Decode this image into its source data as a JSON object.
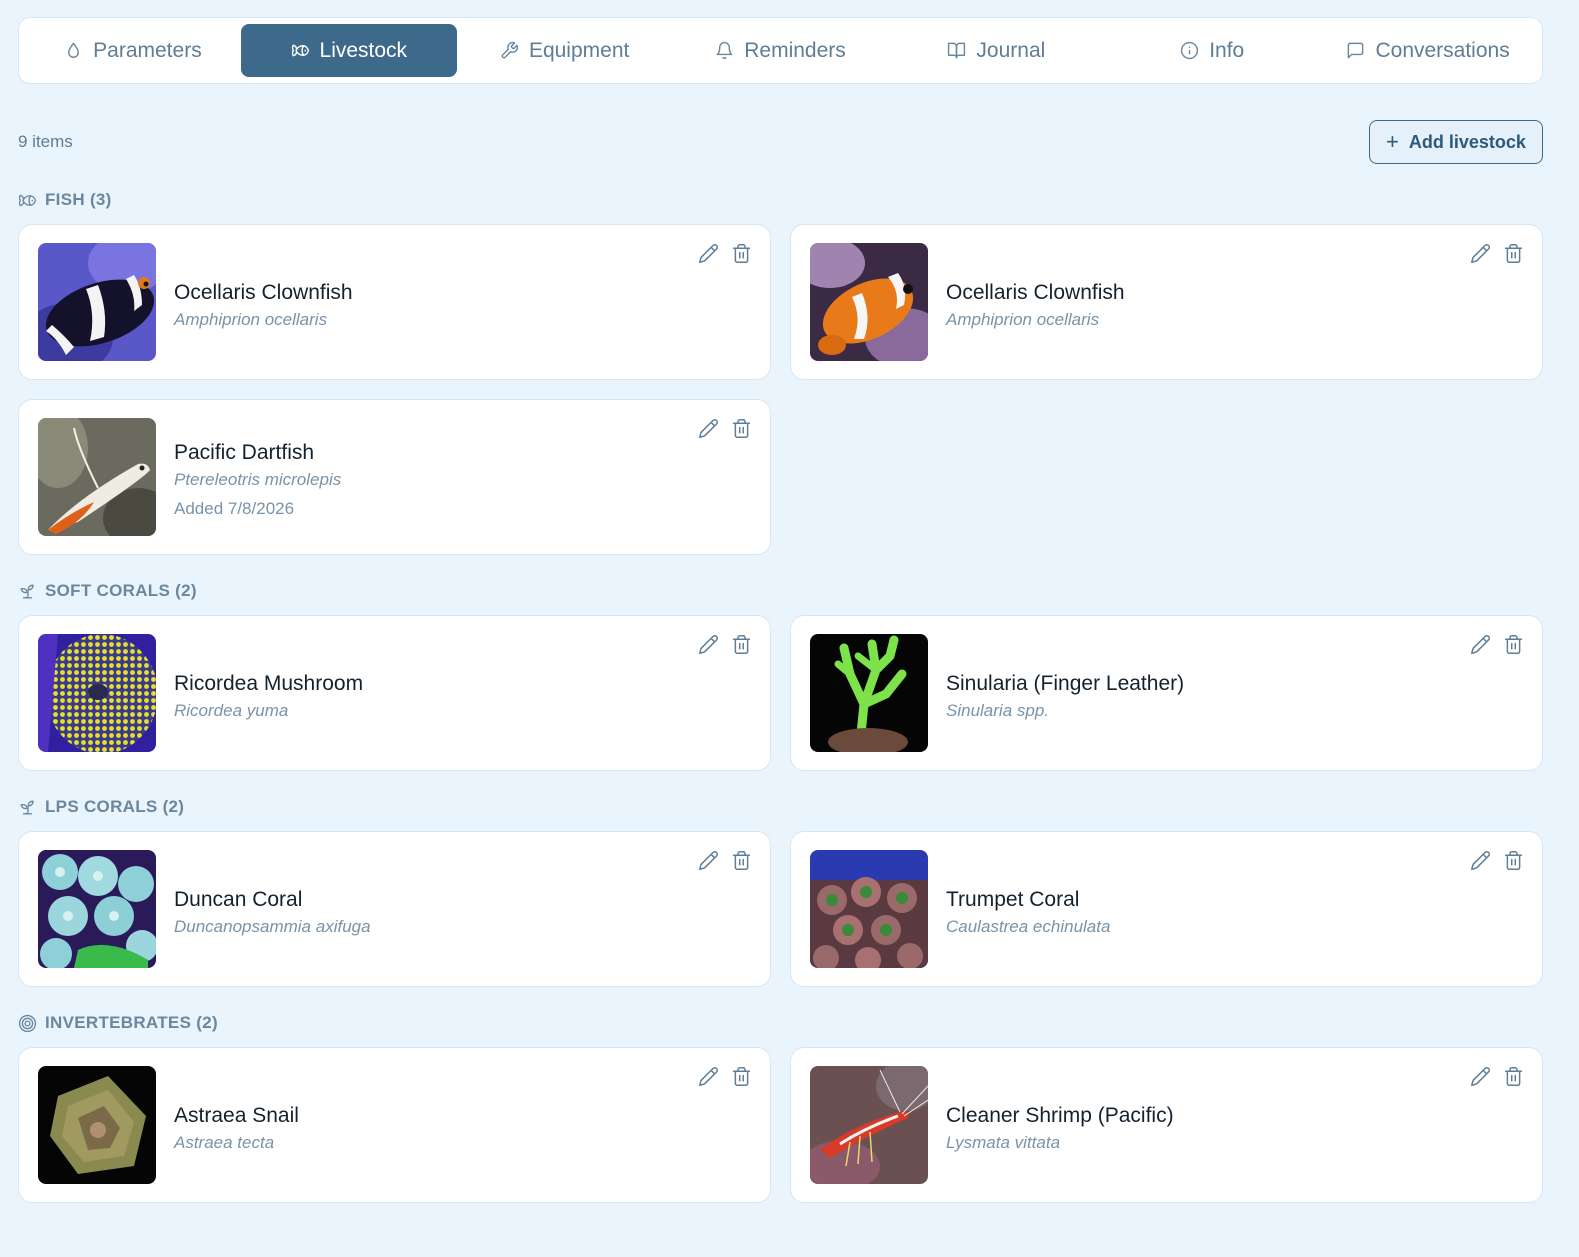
{
  "tabs": [
    {
      "label": "Parameters",
      "icon": "droplet-icon",
      "active": false
    },
    {
      "label": "Livestock",
      "icon": "fish-icon",
      "active": true
    },
    {
      "label": "Equipment",
      "icon": "wrench-icon",
      "active": false
    },
    {
      "label": "Reminders",
      "icon": "bell-icon",
      "active": false
    },
    {
      "label": "Journal",
      "icon": "book-icon",
      "active": false
    },
    {
      "label": "Info",
      "icon": "info-icon",
      "active": false
    },
    {
      "label": "Conversations",
      "icon": "message-icon",
      "active": false
    }
  ],
  "toolbar": {
    "count": "9 items",
    "add_label": "Add livestock",
    "add_icon": "plus-icon"
  },
  "sections": {
    "fish": {
      "title": "FISH (3)",
      "icon": "fish-icon",
      "items": [
        {
          "name": "Ocellaris Clownfish",
          "scientific": "Amphiprion ocellaris",
          "photo": "black-clownfish-photo"
        },
        {
          "name": "Ocellaris Clownfish",
          "scientific": "Amphiprion ocellaris",
          "photo": "orange-clownfish-photo"
        },
        {
          "name": "Pacific Dartfish",
          "scientific": "Ptereleotris microlepis",
          "added": "Added 7/8/2026",
          "photo": "dartfish-photo"
        }
      ]
    },
    "soft_corals": {
      "title": "SOFT CORALS (2)",
      "icon": "sprout-icon",
      "items": [
        {
          "name": "Ricordea Mushroom",
          "scientific": "Ricordea yuma",
          "photo": "ricordea-photo"
        },
        {
          "name": "Sinularia (Finger Leather)",
          "scientific": "Sinularia spp.",
          "photo": "sinularia-photo"
        }
      ]
    },
    "lps_corals": {
      "title": "LPS CORALS (2)",
      "icon": "sprout-icon",
      "items": [
        {
          "name": "Duncan Coral",
          "scientific": "Duncanopsammia axifuga",
          "photo": "duncan-photo"
        },
        {
          "name": "Trumpet Coral",
          "scientific": "Caulastrea echinulata",
          "photo": "trumpet-photo"
        }
      ]
    },
    "invertebrates": {
      "title": "INVERTEBRATES (2)",
      "icon": "shell-icon",
      "items": [
        {
          "name": "Astraea Snail",
          "scientific": "Astraea tecta",
          "photo": "snail-photo"
        },
        {
          "name": "Cleaner Shrimp (Pacific)",
          "scientific": "Lysmata vittata",
          "photo": "shrimp-photo"
        }
      ]
    }
  },
  "card_actions": {
    "edit_icon": "pencil-icon",
    "delete_icon": "trash-icon"
  },
  "colors": {
    "accent": "#3d6a8a",
    "background": "#eaf4fc",
    "card": "#ffffff",
    "muted": "#6a879e"
  }
}
